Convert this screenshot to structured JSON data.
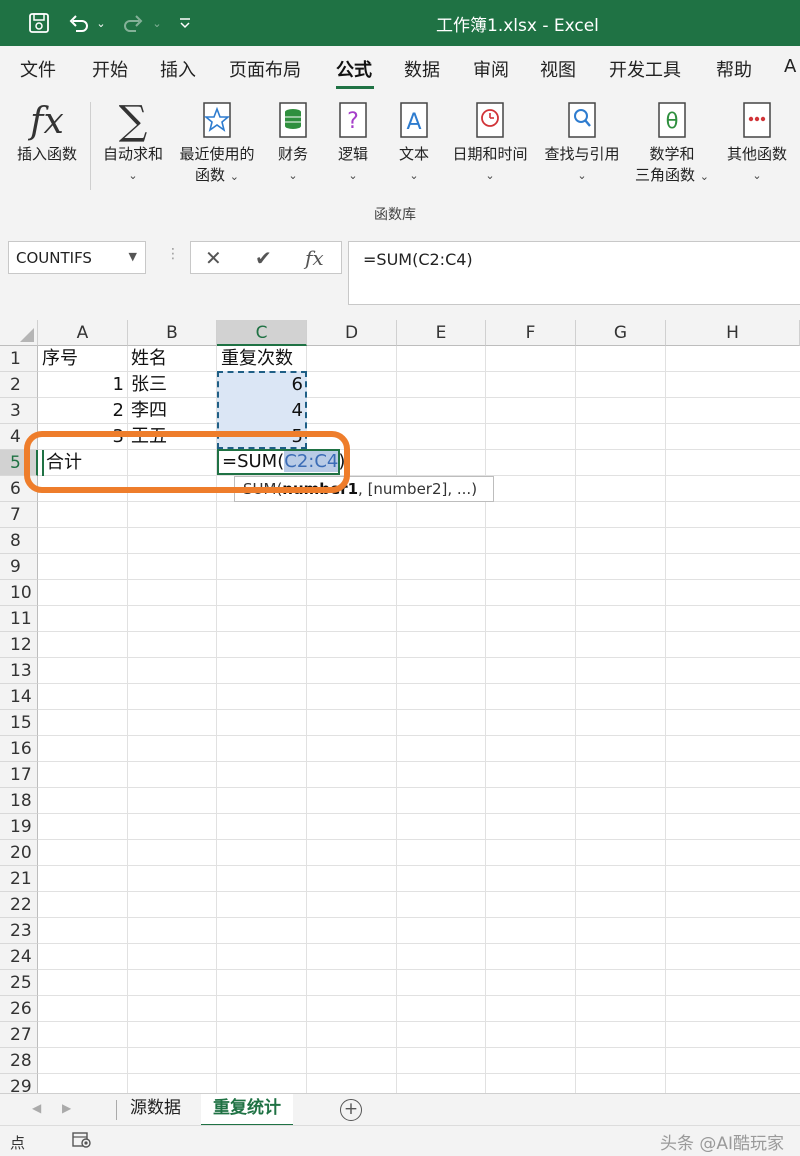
{
  "titlebar": {
    "title": "工作簿1.xlsx  -  Excel"
  },
  "ribbon_tabs": [
    "文件",
    "开始",
    "插入",
    "页面布局",
    "公式",
    "数据",
    "审阅",
    "视图",
    "开发工具",
    "帮助",
    "A"
  ],
  "active_tab": "公式",
  "ribbon_buttons": [
    {
      "label": "插入函数",
      "icon": "fx-icon"
    },
    {
      "label": "自动求和",
      "icon": "sigma-icon"
    },
    {
      "label": "最近使用的",
      "label2": "函数",
      "icon": "star-book-icon"
    },
    {
      "label": "财务",
      "icon": "coins-book-icon"
    },
    {
      "label": "逻辑",
      "icon": "question-book-icon"
    },
    {
      "label": "文本",
      "icon": "text-book-icon"
    },
    {
      "label": "日期和时间",
      "icon": "clock-book-icon"
    },
    {
      "label": "查找与引用",
      "icon": "magnifier-book-icon"
    },
    {
      "label": "数学和",
      "label2": "三角函数",
      "icon": "theta-book-icon"
    },
    {
      "label": "其他函数",
      "icon": "dots-book-icon"
    }
  ],
  "group_label": "函数库",
  "formula_bar": {
    "name_box": "COUNTIFS",
    "formula": "=SUM(C2:C4)"
  },
  "columns": [
    "A",
    "B",
    "C",
    "D",
    "E",
    "F",
    "G",
    "H"
  ],
  "rows": [
    "1",
    "2",
    "3",
    "4",
    "5",
    "6",
    "7",
    "8",
    "9",
    "10",
    "11",
    "12",
    "13",
    "14",
    "15",
    "16",
    "17",
    "18",
    "19",
    "20",
    "21",
    "22",
    "23",
    "24",
    "25",
    "26",
    "27",
    "28",
    "29"
  ],
  "cells": {
    "a1": "序号",
    "b1": "姓名",
    "c1": "重复次数",
    "a2": "1",
    "b2": "张三",
    "c2": "6",
    "a3": "2",
    "b3": "李四",
    "c3": "4",
    "a4": "3",
    "b4": "王五",
    "c4": "5",
    "a5": "合计"
  },
  "editing": {
    "prefix": "=SUM(",
    "ref": "C2:C4",
    "suffix": ")"
  },
  "tooltip": {
    "func": "SUM(",
    "arg1": "number1",
    "rest": ", [number2], ...)"
  },
  "sheets": [
    "源数据",
    "重复统计"
  ],
  "active_sheet": "重复统计",
  "status": {
    "mode": "点"
  },
  "watermark": "头条 @AI酷玩家",
  "colors": {
    "excel_green": "#1f7244",
    "highlight_orange": "#ee7d2b",
    "selection_blue": "#dbe6f5"
  }
}
